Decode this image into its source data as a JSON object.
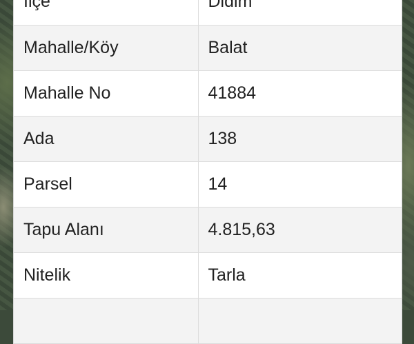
{
  "parcel_info": {
    "rows": [
      {
        "label": "İlçe",
        "value": "Didim"
      },
      {
        "label": "Mahalle/Köy",
        "value": "Balat"
      },
      {
        "label": "Mahalle No",
        "value": "41884"
      },
      {
        "label": "Ada",
        "value": "138"
      },
      {
        "label": "Parsel",
        "value": "14"
      },
      {
        "label": "Tapu Alanı",
        "value": "4.815,63"
      },
      {
        "label": "Nitelik",
        "value": "Tarla"
      },
      {
        "label": "",
        "value": ""
      }
    ]
  },
  "colors": {
    "row_alt": "#f3f3f3",
    "text": "#212121",
    "border": "#dcdcdc"
  }
}
